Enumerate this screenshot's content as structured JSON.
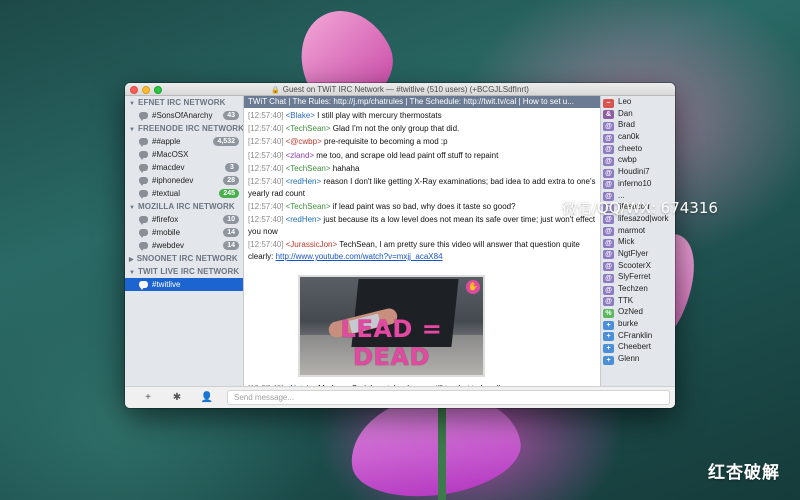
{
  "window": {
    "title": "Guest on TWiT IRC Network — #twitlive (510 users) (+BCGJLSdfInrt)"
  },
  "sidebar": {
    "networks": [
      {
        "name": "EFNET IRC NETWORK",
        "channels": [
          {
            "name": "#SonsOfAnarchy",
            "count": "43",
            "green": false
          }
        ]
      },
      {
        "name": "FREENODE IRC NETWORK",
        "channels": [
          {
            "name": "##apple",
            "count": "4,532",
            "green": false
          },
          {
            "name": "#MacOSX",
            "count": "",
            "green": false
          },
          {
            "name": "#macdev",
            "count": "3",
            "green": false
          },
          {
            "name": "#iphonedev",
            "count": "28",
            "green": false
          },
          {
            "name": "#textual",
            "count": "245",
            "green": true
          }
        ]
      },
      {
        "name": "MOZILLA IRC NETWORK",
        "channels": [
          {
            "name": "#firefox",
            "count": "10",
            "green": false
          },
          {
            "name": "#mobile",
            "count": "14",
            "green": false
          },
          {
            "name": "#webdev",
            "count": "14",
            "green": false
          }
        ]
      },
      {
        "name": "SNOONET IRC NETWORK",
        "channels": []
      },
      {
        "name": "TWIT LIVE IRC NETWORK",
        "channels": [
          {
            "name": "#twitlive",
            "count": "",
            "green": false,
            "selected": true
          }
        ]
      }
    ]
  },
  "topic": "TWiT Chat | The Rules: http://j.mp/chatrules | The Schedule: http://twit.tv/cal | How to set u...",
  "messages": [
    {
      "ts": "[12:57:40]",
      "nick": "<Blake>",
      "nick_color": "#2b6cc4",
      "text": " I still play with mercury thermostats"
    },
    {
      "ts": "[12:57:40]",
      "nick": "<TechSean>",
      "nick_color": "#3f8f3f",
      "text": " Glad I'm not the only group that did."
    },
    {
      "ts": "[12:57:40]",
      "nick": "<@cwbp>",
      "nick_color": "#c0392b",
      "text": " pre-requisite to becoming a mod :p"
    },
    {
      "ts": "[12:57:40]",
      "nick": "<zland>",
      "nick_color": "#8e44ad",
      "text": " me too, and scrape old lead paint off stuff to repaint"
    },
    {
      "ts": "[12:57:40]",
      "nick": "<TechSean>",
      "nick_color": "#3f8f3f",
      "text": " hahaha"
    },
    {
      "ts": "[12:57:40]",
      "nick": "<redHen>",
      "nick_color": "#1f6fb5",
      "text": " reason I don't like getting X-Ray examinations; bad idea to add extra to one's yearly rad count"
    },
    {
      "ts": "[12:57:40]",
      "nick": "<TechSean>",
      "nick_color": "#3f8f3f",
      "text": " if lead paint was so bad, why does it taste so good?"
    },
    {
      "ts": "[12:57:40]",
      "nick": "<redHen>",
      "nick_color": "#1f6fb5",
      "text": " just because its a low level does not mean its safe over time; just won't effect you now"
    },
    {
      "ts": "[12:57:40]",
      "nick": "<JurassicJon>",
      "nick_color": "#c0392b",
      "text": " TechSean, I am pretty sure this video will answer that question quite clearly: ",
      "link": "http://www.youtube.com/watch?v=mxjj_acaX84",
      "mention": "TechSean"
    }
  ],
  "preview": {
    "caption": "LEAD = DEAD"
  },
  "last_message": {
    "ts": "[12:57:40]",
    "nick": "<Natch>",
    "nick_color": "#2b6cc4",
    "text": " Madame Curie's notebooks are still too hot to handle"
  },
  "users": [
    {
      "mode": "~",
      "color": "#d9534f",
      "name": "Leo"
    },
    {
      "mode": "&",
      "color": "#8e5ea2",
      "name": "Dan"
    },
    {
      "mode": "@",
      "color": "#8e7cc3",
      "name": "Brad"
    },
    {
      "mode": "@",
      "color": "#8e7cc3",
      "name": "can0k"
    },
    {
      "mode": "@",
      "color": "#8e7cc3",
      "name": "cheeto"
    },
    {
      "mode": "@",
      "color": "#8e7cc3",
      "name": "cwbp"
    },
    {
      "mode": "@",
      "color": "#8e7cc3",
      "name": "Houdini7"
    },
    {
      "mode": "@",
      "color": "#8e7cc3",
      "name": "inferno10"
    },
    {
      "mode": "@",
      "color": "#8e7cc3",
      "name": "..."
    },
    {
      "mode": "@",
      "color": "#8e7cc3",
      "name": "lifesazod"
    },
    {
      "mode": "@",
      "color": "#8e7cc3",
      "name": "lifesazod|work"
    },
    {
      "mode": "@",
      "color": "#8e7cc3",
      "name": "marmot"
    },
    {
      "mode": "@",
      "color": "#8e7cc3",
      "name": "Mick"
    },
    {
      "mode": "@",
      "color": "#8e7cc3",
      "name": "NgtFlyer"
    },
    {
      "mode": "@",
      "color": "#8e7cc3",
      "name": "ScooterX"
    },
    {
      "mode": "@",
      "color": "#8e7cc3",
      "name": "SlyFerret"
    },
    {
      "mode": "@",
      "color": "#8e7cc3",
      "name": "Techzen"
    },
    {
      "mode": "@",
      "color": "#8e7cc3",
      "name": "TTK"
    },
    {
      "mode": "%",
      "color": "#5cb85c",
      "name": "OzNed"
    },
    {
      "mode": "+",
      "color": "#4a8fd8",
      "name": "burke"
    },
    {
      "mode": "+",
      "color": "#4a8fd8",
      "name": "CFranklin"
    },
    {
      "mode": "+",
      "color": "#4a8fd8",
      "name": "Cheebert"
    },
    {
      "mode": "+",
      "color": "#4a8fd8",
      "name": "Glenn"
    }
  ],
  "input": {
    "placeholder": "Send message..."
  },
  "icons": {
    "add": "+",
    "settings": "✱",
    "user": "👤"
  },
  "overlay": {
    "watermark": "微信/QQ/WX: 674316",
    "logo": "红杏破解"
  }
}
